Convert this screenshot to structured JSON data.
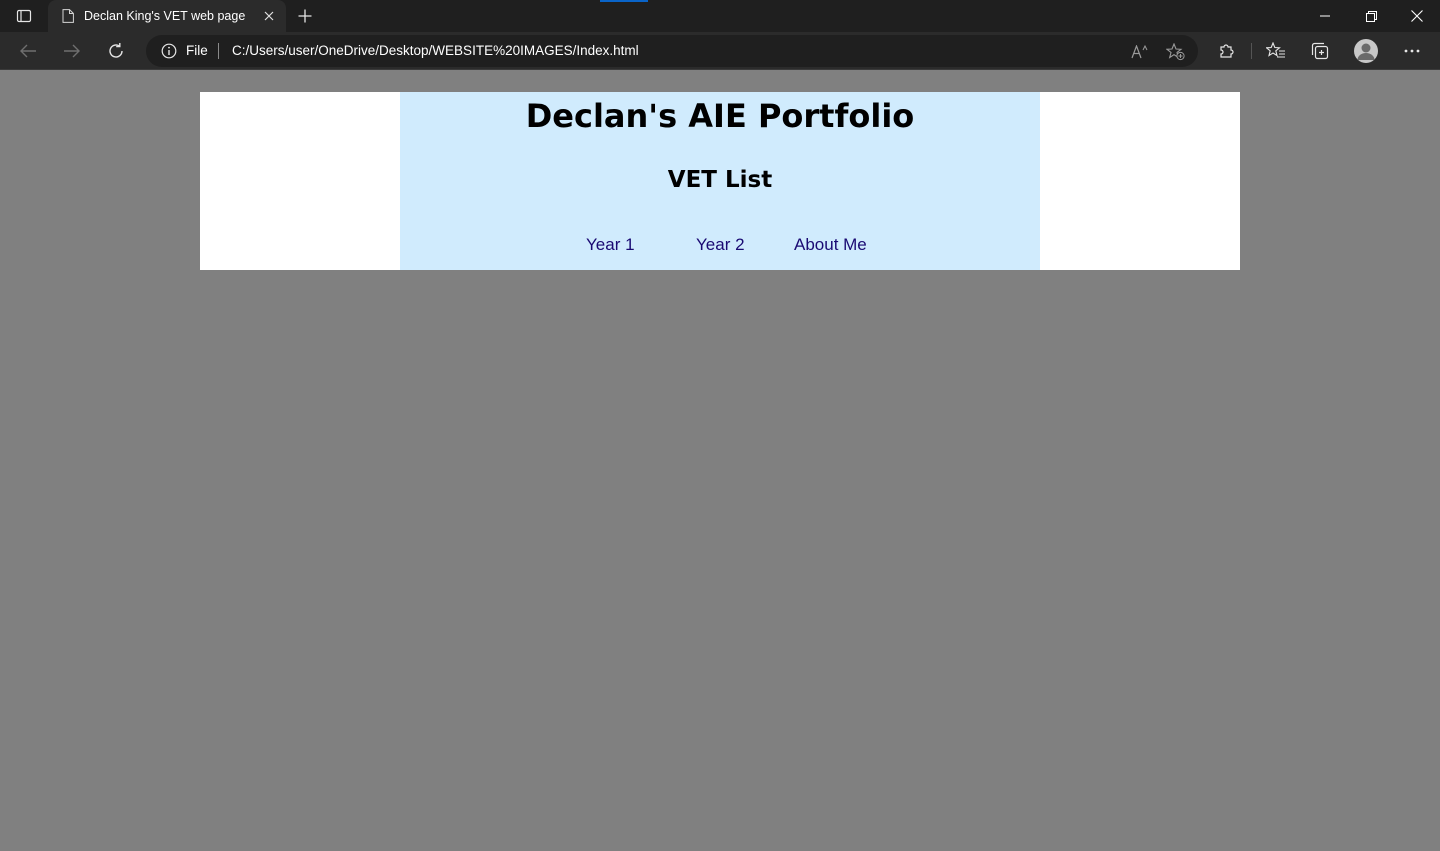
{
  "browser": {
    "tab": {
      "title": "Declan King's VET web page"
    },
    "address": {
      "scheme_label": "File",
      "url": "C:/Users/user/OneDrive/Desktop/WEBSITE%20IMAGES/Index.html"
    },
    "icons": {
      "tab_actions": "tab-actions-icon",
      "tab_page": "document-icon",
      "tab_close": "close-icon",
      "new_tab": "plus-icon",
      "back": "back-arrow-icon",
      "forward": "forward-arrow-icon",
      "refresh": "refresh-icon",
      "site_info": "info-icon",
      "read_aloud": "read-aloud-icon",
      "add_favorite": "add-favorite-icon",
      "extensions": "extensions-icon",
      "favorites": "favorites-icon",
      "collections": "collections-icon",
      "profile": "profile-icon",
      "more": "more-icon",
      "minimize": "minimize-icon",
      "restore": "restore-icon",
      "close_window": "close-icon"
    },
    "colors": {
      "chrome_dark": "#1f1f1f",
      "chrome_mid": "#2b2b2b",
      "accent": "#0a64c8"
    }
  },
  "page": {
    "title": "Declan's AIE Portfolio",
    "subtitle": "VET List",
    "nav": [
      {
        "label": "Year 1"
      },
      {
        "label": "Year 2"
      },
      {
        "label": "About Me"
      }
    ],
    "colors": {
      "background": "#808080",
      "header_outer": "#ffffff",
      "header_inner": "#d0ebfd",
      "link": "#1a0a73"
    }
  }
}
